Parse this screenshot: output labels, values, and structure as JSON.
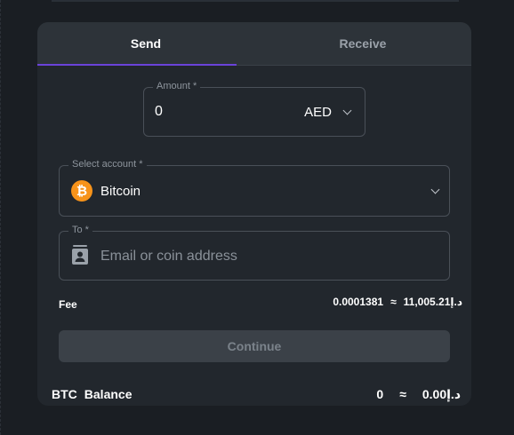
{
  "tabs": {
    "send": "Send",
    "receive": "Receive",
    "active": "Send"
  },
  "amount": {
    "label": "Amount *",
    "value": "0",
    "currency": "AED"
  },
  "account": {
    "label": "Select account *",
    "name": "Bitcoin",
    "icon": "bitcoin-icon",
    "icon_glyph": "₿",
    "icon_color": "#f7931a"
  },
  "recipient": {
    "label": "To *",
    "placeholder": "Email or coin address",
    "value": "",
    "icon": "contact-card-icon"
  },
  "fee": {
    "label": "Fee",
    "crypto": "0.0001381",
    "approx": "≈",
    "fiat": "د.إ11,005.21"
  },
  "continue_label": "Continue",
  "balance": {
    "ticker": "BTC",
    "label": "Balance",
    "crypto": "0",
    "approx": "≈",
    "fiat": "د.إ0.00"
  },
  "colors": {
    "accent": "#6a43d9",
    "bitcoin": "#f7931a",
    "card_background": "#22272d",
    "page_background": "#1a1e23"
  }
}
